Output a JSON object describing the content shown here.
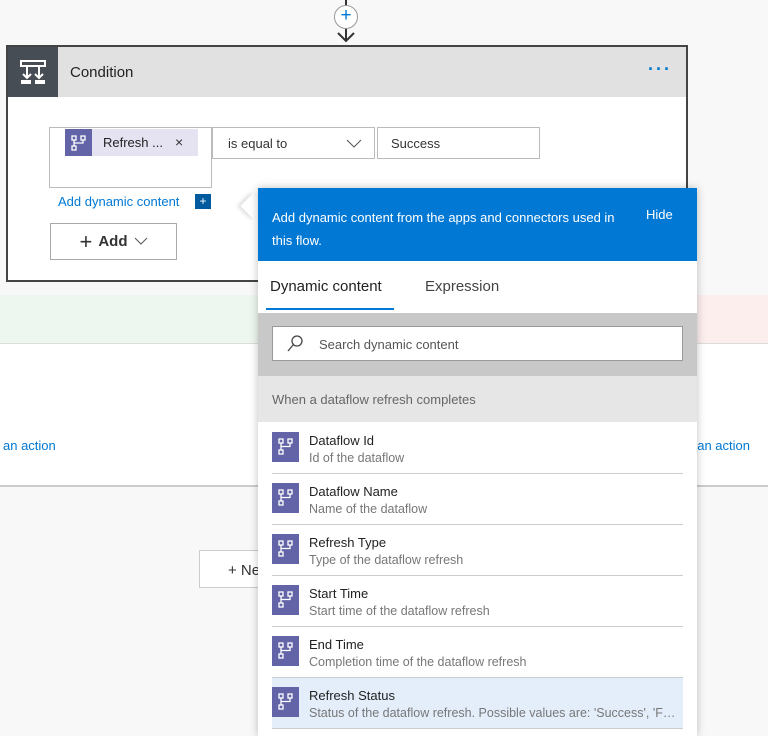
{
  "condition": {
    "title": "Condition",
    "menu": "···",
    "token_label": "Refresh ...",
    "token_remove": "×",
    "operator": "is equal to",
    "value": "Success",
    "add_dynamic": "Add dynamic content",
    "add_dynamic_plus": "+",
    "add_button": "Add"
  },
  "canvas": {
    "left_action": "an action",
    "right_action": "an action",
    "new_step": "+ Ne"
  },
  "popup": {
    "header": "Add dynamic content from the apps and connectors used in this flow.",
    "hide": "Hide",
    "tabs": [
      {
        "label": "Dynamic content",
        "active": true
      },
      {
        "label": "Expression",
        "active": false
      }
    ],
    "search_placeholder": "Search dynamic content",
    "section": "When a dataflow refresh completes",
    "items": [
      {
        "title": "Dataflow Id",
        "desc": "Id of the dataflow"
      },
      {
        "title": "Dataflow Name",
        "desc": "Name of the dataflow"
      },
      {
        "title": "Refresh Type",
        "desc": "Type of the dataflow refresh"
      },
      {
        "title": "Start Time",
        "desc": "Start time of the dataflow refresh"
      },
      {
        "title": "End Time",
        "desc": "Completion time of the dataflow refresh"
      },
      {
        "title": "Refresh Status",
        "desc": "Status of the dataflow refresh. Possible values are: 'Success', 'Failed'"
      }
    ]
  },
  "colors": {
    "accent": "#0078d4",
    "connector": "#6264a7"
  }
}
